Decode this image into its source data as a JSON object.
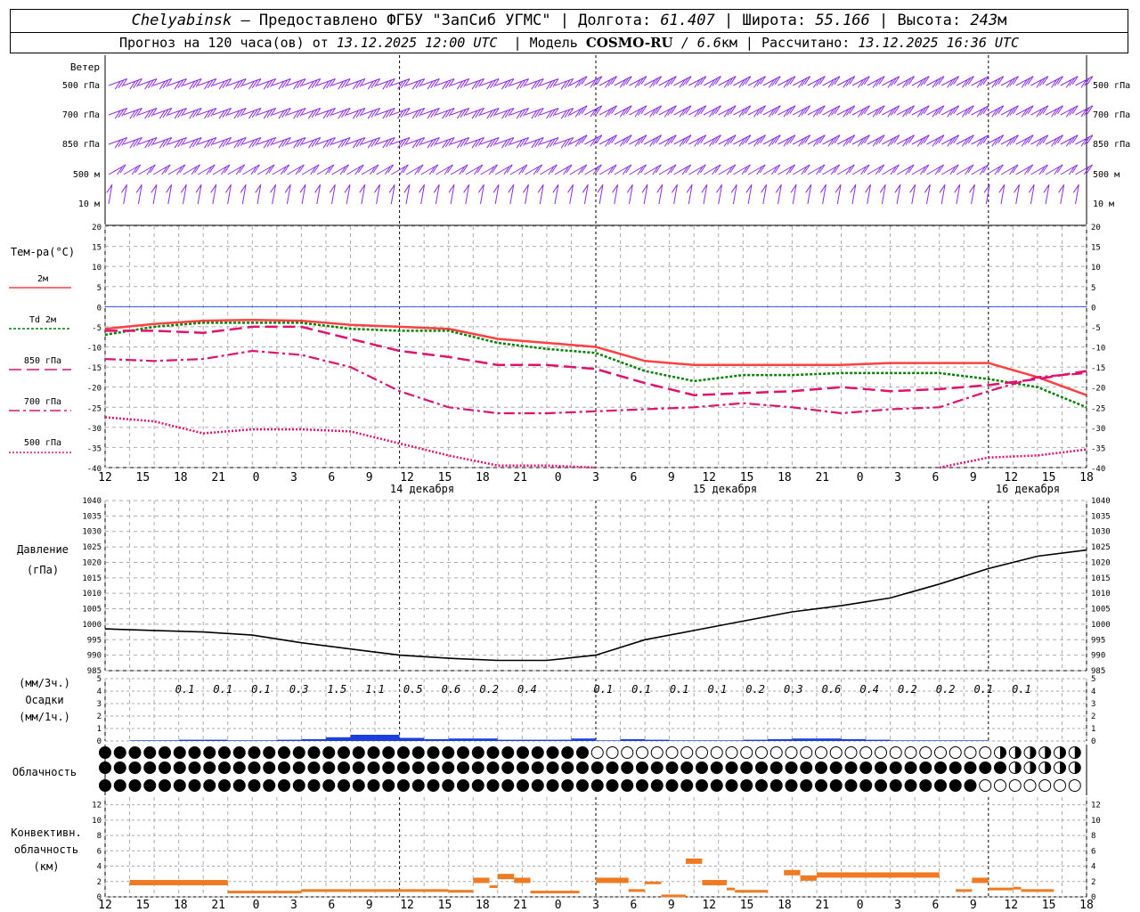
{
  "header": {
    "station": "Chelyabinsk",
    "provider": "— Предоставлено ФГБУ \"ЗапСиб УГМС\"",
    "lon_label": "Долгота:",
    "lon": "61.407",
    "lat_label": "Широта:",
    "lat": "55.166",
    "alt_label": "Высота:",
    "alt": "243",
    "alt_unit": "м",
    "forecast_prefix": "Прогноз на 120 часа(ов) от",
    "forecast_time": "13.12.2025 12:00 UTC",
    "model_label": "Модель",
    "model_name": "COSMO-RU",
    "model_res": "/ 6.6",
    "model_res_unit": "км",
    "calc_label": "Рассчитано:",
    "calc_time": "13.12.2025 16:36 UTC"
  },
  "colors": {
    "wind": "#8a2be2",
    "t2m": "#ff4040",
    "td2m": "#008000",
    "t850": "#e0106e",
    "zero": "#3050ff",
    "precip": "#1a3fe0",
    "conv": "#ee7b22",
    "grid": "#aaaaaa"
  },
  "time_axis": {
    "ticks": [
      "12",
      "15",
      "18",
      "21",
      "0",
      "3",
      "6",
      "9",
      "12",
      "15",
      "18",
      "21",
      "0",
      "3",
      "6",
      "9",
      "12",
      "15",
      "18",
      "21",
      "0",
      "3",
      "6",
      "9",
      "12",
      "15",
      "18"
    ],
    "dates": [
      "14 декабря",
      "15 декабря",
      "16 декабря"
    ]
  },
  "wind": {
    "title": "Ветер",
    "levels": [
      "500 гПа",
      "700 гПа",
      "850 гПа",
      "500 м",
      "10 м"
    ]
  },
  "temperature": {
    "title": "Тем-ра(°C)",
    "yticks": [
      "20",
      "15",
      "10",
      "5",
      "0",
      "-5",
      "-10",
      "-15",
      "-20",
      "-25",
      "-30",
      "-35",
      "-40"
    ],
    "legend": [
      "2м",
      "Td 2м",
      "850 гПа",
      "700 гПа",
      "500 гПа"
    ]
  },
  "pressure": {
    "title": "Давление",
    "unit": "(гПа)",
    "yticks": [
      "1040",
      "1035",
      "1030",
      "1025",
      "1020",
      "1015",
      "1010",
      "1005",
      "1000",
      "995",
      "990",
      "985"
    ]
  },
  "precip": {
    "unit3h": "(мм/3ч.)",
    "title": "Осадки",
    "unit1h": "(мм/1ч.)",
    "yticks": [
      "5",
      "4",
      "3",
      "2",
      "1",
      "0"
    ],
    "totals3h": [
      "0.1",
      "0.1",
      "0.1",
      "0.3",
      "1.5",
      "1.1",
      "0.5",
      "0.6",
      "0.2",
      "0.4",
      "",
      "0.1",
      "0.1",
      "0.1",
      "0.1",
      "0.2",
      "0.3",
      "0.6",
      "0.4",
      "0.2",
      "0.2",
      "0.1",
      "0.1"
    ]
  },
  "cloud": {
    "title": "Облачность"
  },
  "convective": {
    "title1": "Конвективн.",
    "title2": "облачность",
    "unit": "(км)",
    "yticks": [
      "12",
      "10",
      "8",
      "6",
      "4",
      "2",
      "0"
    ]
  },
  "chart_data": [
    {
      "type": "line",
      "panel": "temperature",
      "x_hours": [
        0,
        6,
        12,
        18,
        24,
        30,
        36,
        42,
        48,
        54,
        60,
        66,
        72,
        78,
        84,
        90,
        96,
        102,
        108,
        114,
        120
      ],
      "ylim": [
        -40,
        20
      ],
      "series": [
        {
          "name": "2м",
          "values": [
            -5.5,
            -4.3,
            -3.5,
            -3.3,
            -3.5,
            -4.5,
            -5,
            -5.5,
            -8,
            -9,
            -10,
            -13.5,
            -14.5,
            -14.5,
            -14.5,
            -14.5,
            -14,
            -14,
            -14,
            -17.5,
            -22
          ]
        },
        {
          "name": "Td 2м",
          "values": [
            -7,
            -5,
            -4,
            -4,
            -4,
            -5.5,
            -6,
            -6,
            -9,
            -10.5,
            -11.5,
            -16,
            -18.5,
            -17,
            -17,
            -16.5,
            -16.5,
            -16.5,
            -18,
            -20,
            -25
          ]
        },
        {
          "name": "850 гПа",
          "values": [
            -6,
            -6,
            -6.5,
            -5,
            -5,
            -8,
            -11,
            -12.5,
            -14.5,
            -14.5,
            -15.5,
            -19,
            -22,
            -21.5,
            -21,
            -20,
            -21,
            -20.5,
            -19.5,
            -18,
            -16
          ]
        },
        {
          "name": "700 гПа",
          "values": [
            -13,
            -13.5,
            -13,
            -11,
            -12,
            -15,
            -21,
            -25,
            -26.5,
            -26.5,
            -26,
            -25.5,
            -25,
            -24,
            -25,
            -26.5,
            -25.5,
            -25,
            -21,
            -17.5,
            -16.5
          ]
        },
        {
          "name": "500 гПа",
          "values": [
            -27.5,
            -28.5,
            -31.5,
            -30.5,
            -30.5,
            -31,
            -34,
            -37,
            -39.5,
            -39.5,
            -40,
            null,
            null,
            null,
            null,
            null,
            null,
            -40,
            -37.5,
            -37,
            -35.5
          ]
        }
      ]
    },
    {
      "type": "line",
      "panel": "pressure",
      "x_hours": [
        0,
        6,
        12,
        18,
        24,
        30,
        36,
        42,
        48,
        54,
        60,
        66,
        72,
        78,
        84,
        90,
        96,
        102,
        108,
        114,
        120
      ],
      "ylim": [
        985,
        1040
      ],
      "series": [
        {
          "name": "",
          "values": [
            998.5,
            998,
            997.5,
            996.5,
            994,
            992,
            990,
            989,
            988.3,
            988.3,
            990,
            995,
            998,
            1001,
            1004,
            1006,
            1008.5,
            1013,
            1018,
            1022,
            1024
          ]
        }
      ]
    },
    {
      "type": "bar",
      "panel": "precip_1h",
      "ylim": [
        0,
        5
      ],
      "x_hours": [
        3,
        6,
        9,
        12,
        15,
        18,
        21,
        24,
        27,
        30,
        33,
        36,
        39,
        42,
        45,
        48,
        51,
        54,
        57,
        60,
        63,
        66,
        69,
        72,
        75,
        78,
        81,
        84,
        87,
        90,
        93,
        96,
        99,
        102,
        105
      ],
      "values": [
        0.05,
        0.05,
        0.1,
        0.1,
        0.05,
        0.05,
        0.1,
        0.15,
        0.3,
        0.5,
        0.5,
        0.25,
        0.15,
        0.2,
        0.2,
        0.1,
        0.1,
        0.1,
        0.2,
        0.05,
        0.15,
        0.1,
        0.05,
        0.05,
        0.05,
        0.1,
        0.15,
        0.2,
        0.2,
        0.15,
        0.1,
        0.05,
        0.05,
        0.05,
        0.05
      ]
    },
    {
      "type": "bar",
      "panel": "convective",
      "ylim": [
        0,
        13
      ],
      "segments_hours": [
        [
          3,
          8
        ],
        [
          8,
          15
        ],
        [
          15,
          24
        ],
        [
          24,
          42
        ],
        [
          42,
          45
        ],
        [
          45,
          47
        ],
        [
          47,
          48
        ],
        [
          48,
          50
        ],
        [
          50,
          52
        ],
        [
          52,
          58
        ],
        [
          60,
          64
        ],
        [
          64,
          66
        ],
        [
          66,
          68
        ],
        [
          68,
          71
        ],
        [
          71,
          73
        ],
        [
          73,
          76
        ],
        [
          76,
          77
        ],
        [
          77,
          81
        ],
        [
          83,
          85
        ],
        [
          85,
          87
        ],
        [
          87,
          102
        ],
        [
          104,
          106
        ],
        [
          106,
          108
        ],
        [
          108,
          111
        ],
        [
          111,
          112
        ],
        [
          112,
          116
        ]
      ],
      "values": [
        2.2,
        2.2,
        0.8,
        1,
        0.9,
        2.5,
        1.5,
        3,
        2.5,
        0.8,
        2.5,
        1,
        2,
        0.3,
        5,
        2.2,
        1.2,
        0.9,
        3.5,
        2.8,
        3.2,
        1,
        2.5,
        1.2,
        1.3,
        1
      ]
    }
  ]
}
